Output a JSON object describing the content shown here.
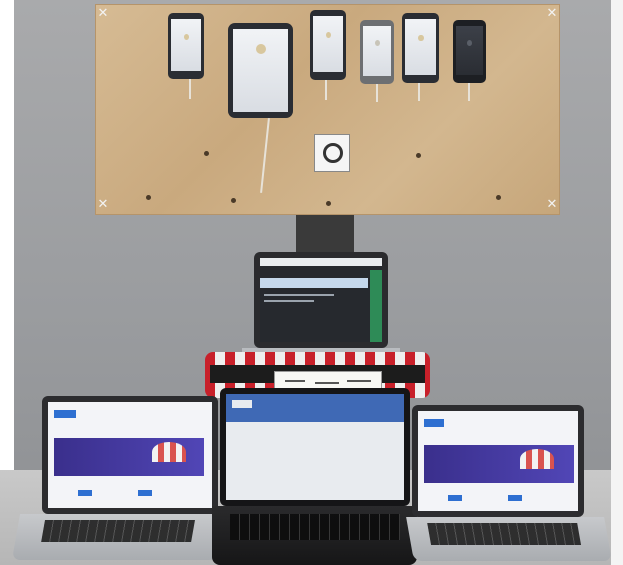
{
  "scene": {
    "description_type": "photo",
    "colors": {
      "wall": "#9a9c9f",
      "board": "#cdb084",
      "brand_blue": "#2e6fd1",
      "hero_purple": "#4a3fa8",
      "crate_red": "#c8202a"
    },
    "icons": [
      "qr-code-icon",
      "umbrella-illustration-icon"
    ]
  }
}
